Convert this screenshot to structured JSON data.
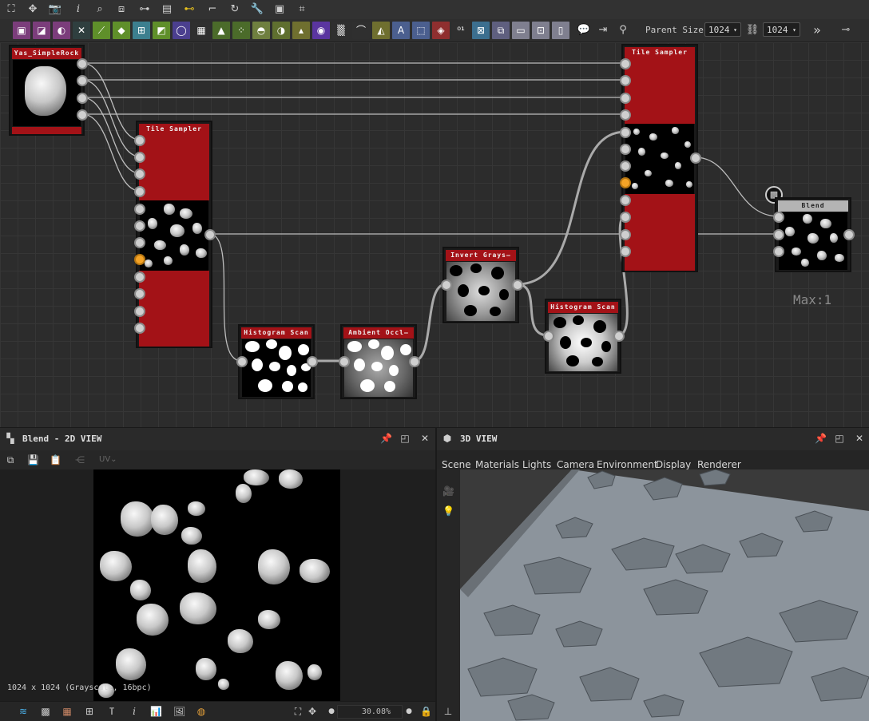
{
  "toolbar": {
    "top_icons": [
      "frame-icon",
      "move-icon",
      "camera-icon",
      "info-icon",
      "search-icon",
      "align-icon",
      "hierarchy-icon",
      "layout-icon",
      "link-icon",
      "connect-icon",
      "history-icon",
      "wrench-icon",
      "snapshot-icon",
      "crop-icon"
    ],
    "node_buttons": [
      {
        "name": "bitmap-node-button",
        "color": "#7b3d7b",
        "glyph": "▣"
      },
      {
        "name": "uniform-color-button",
        "color": "#7b3d7b",
        "glyph": "◪"
      },
      {
        "name": "gradient-map-button",
        "color": "#7b3d7b",
        "glyph": "◐"
      },
      {
        "name": "warp-button",
        "color": "#2f3f3f",
        "glyph": "✕"
      },
      {
        "name": "curve-button",
        "color": "#5f8f2a",
        "glyph": "⟋"
      },
      {
        "name": "shape-button",
        "color": "#5f8f2a",
        "glyph": "◆"
      },
      {
        "name": "noise-button",
        "color": "#3c7f8f",
        "glyph": "⊞"
      },
      {
        "name": "gradient-button",
        "color": "#5f8f2a",
        "glyph": "◩"
      },
      {
        "name": "circle-shape-button",
        "color": "#4b3f8f",
        "glyph": "◯"
      },
      {
        "name": "tile-button",
        "color": "#2f2f2f",
        "glyph": "▦"
      },
      {
        "name": "fill-button",
        "color": "#4b6b2a",
        "glyph": "▲"
      },
      {
        "name": "scatter-button",
        "color": "#4b6b2a",
        "glyph": "⁘"
      },
      {
        "name": "blend-button",
        "color": "#6f7f3f",
        "glyph": "◓"
      },
      {
        "name": "levels-button",
        "color": "#5f6f2f",
        "glyph": "◑"
      },
      {
        "name": "histogram-button",
        "color": "#6f6f2f",
        "glyph": "▴"
      },
      {
        "name": "color-wheel-button",
        "color": "#5a35a0",
        "glyph": "◉"
      },
      {
        "name": "dither-button",
        "color": "#2f2f2f",
        "glyph": "▒"
      },
      {
        "name": "bridge-button",
        "color": "#2f2f2f",
        "glyph": "⌒"
      },
      {
        "name": "mirror-button",
        "color": "#6f6f2f",
        "glyph": "◭"
      },
      {
        "name": "text-button",
        "color": "#4b5f8f",
        "glyph": "A"
      },
      {
        "name": "transform-button",
        "color": "#4b5f8f",
        "glyph": "⬚"
      },
      {
        "name": "paint-button",
        "color": "#8f2f2f",
        "glyph": "◈"
      },
      {
        "name": "value-button",
        "color": "#2f2f2f",
        "glyph": "⁰¹"
      },
      {
        "name": "normal-button",
        "color": "#3c6f8f",
        "glyph": "⊠"
      },
      {
        "name": "pbr-button",
        "color": "#5f5f7f",
        "glyph": "⧉"
      },
      {
        "name": "output-button",
        "color": "#7f7f8f",
        "glyph": "▭"
      },
      {
        "name": "graph-button",
        "color": "#7f7f8f",
        "glyph": "⊡"
      },
      {
        "name": "frame-node-button",
        "color": "#7f7f8f",
        "glyph": "▯"
      }
    ],
    "comment_icon": "comment-icon",
    "export_icon": "export-icon",
    "pin_icon": "pin-icon",
    "parent_size_label": "Parent Size:",
    "parent_size_value_1": "1024",
    "parent_size_value_2": "1024",
    "expand_label": "»",
    "settings_icon": "connector-icon"
  },
  "graph": {
    "nodes": {
      "rock": {
        "title": "Yas_SimpleRock"
      },
      "tile1": {
        "title": "Tile Sampler"
      },
      "hist1": {
        "title": "Histogram Scan"
      },
      "ao": {
        "title": "Ambient Occl—"
      },
      "invert": {
        "title": "Invert Grays—"
      },
      "hist2": {
        "title": "Histogram Scan"
      },
      "tile2": {
        "title": "Tile Sampler"
      },
      "blend": {
        "title": "Blend"
      }
    },
    "max_label": "Max:1"
  },
  "view2d": {
    "title": "Blend - 2D VIEW",
    "uv_label": "UV",
    "status": "1024 x 1024 (Grayscale, 16bpc)",
    "zoom": "30.08%"
  },
  "view3d": {
    "title": "3D VIEW",
    "menu": [
      "Scene",
      "Materials",
      "Lights",
      "Camera",
      "Environment",
      "Display",
      "Renderer"
    ]
  }
}
